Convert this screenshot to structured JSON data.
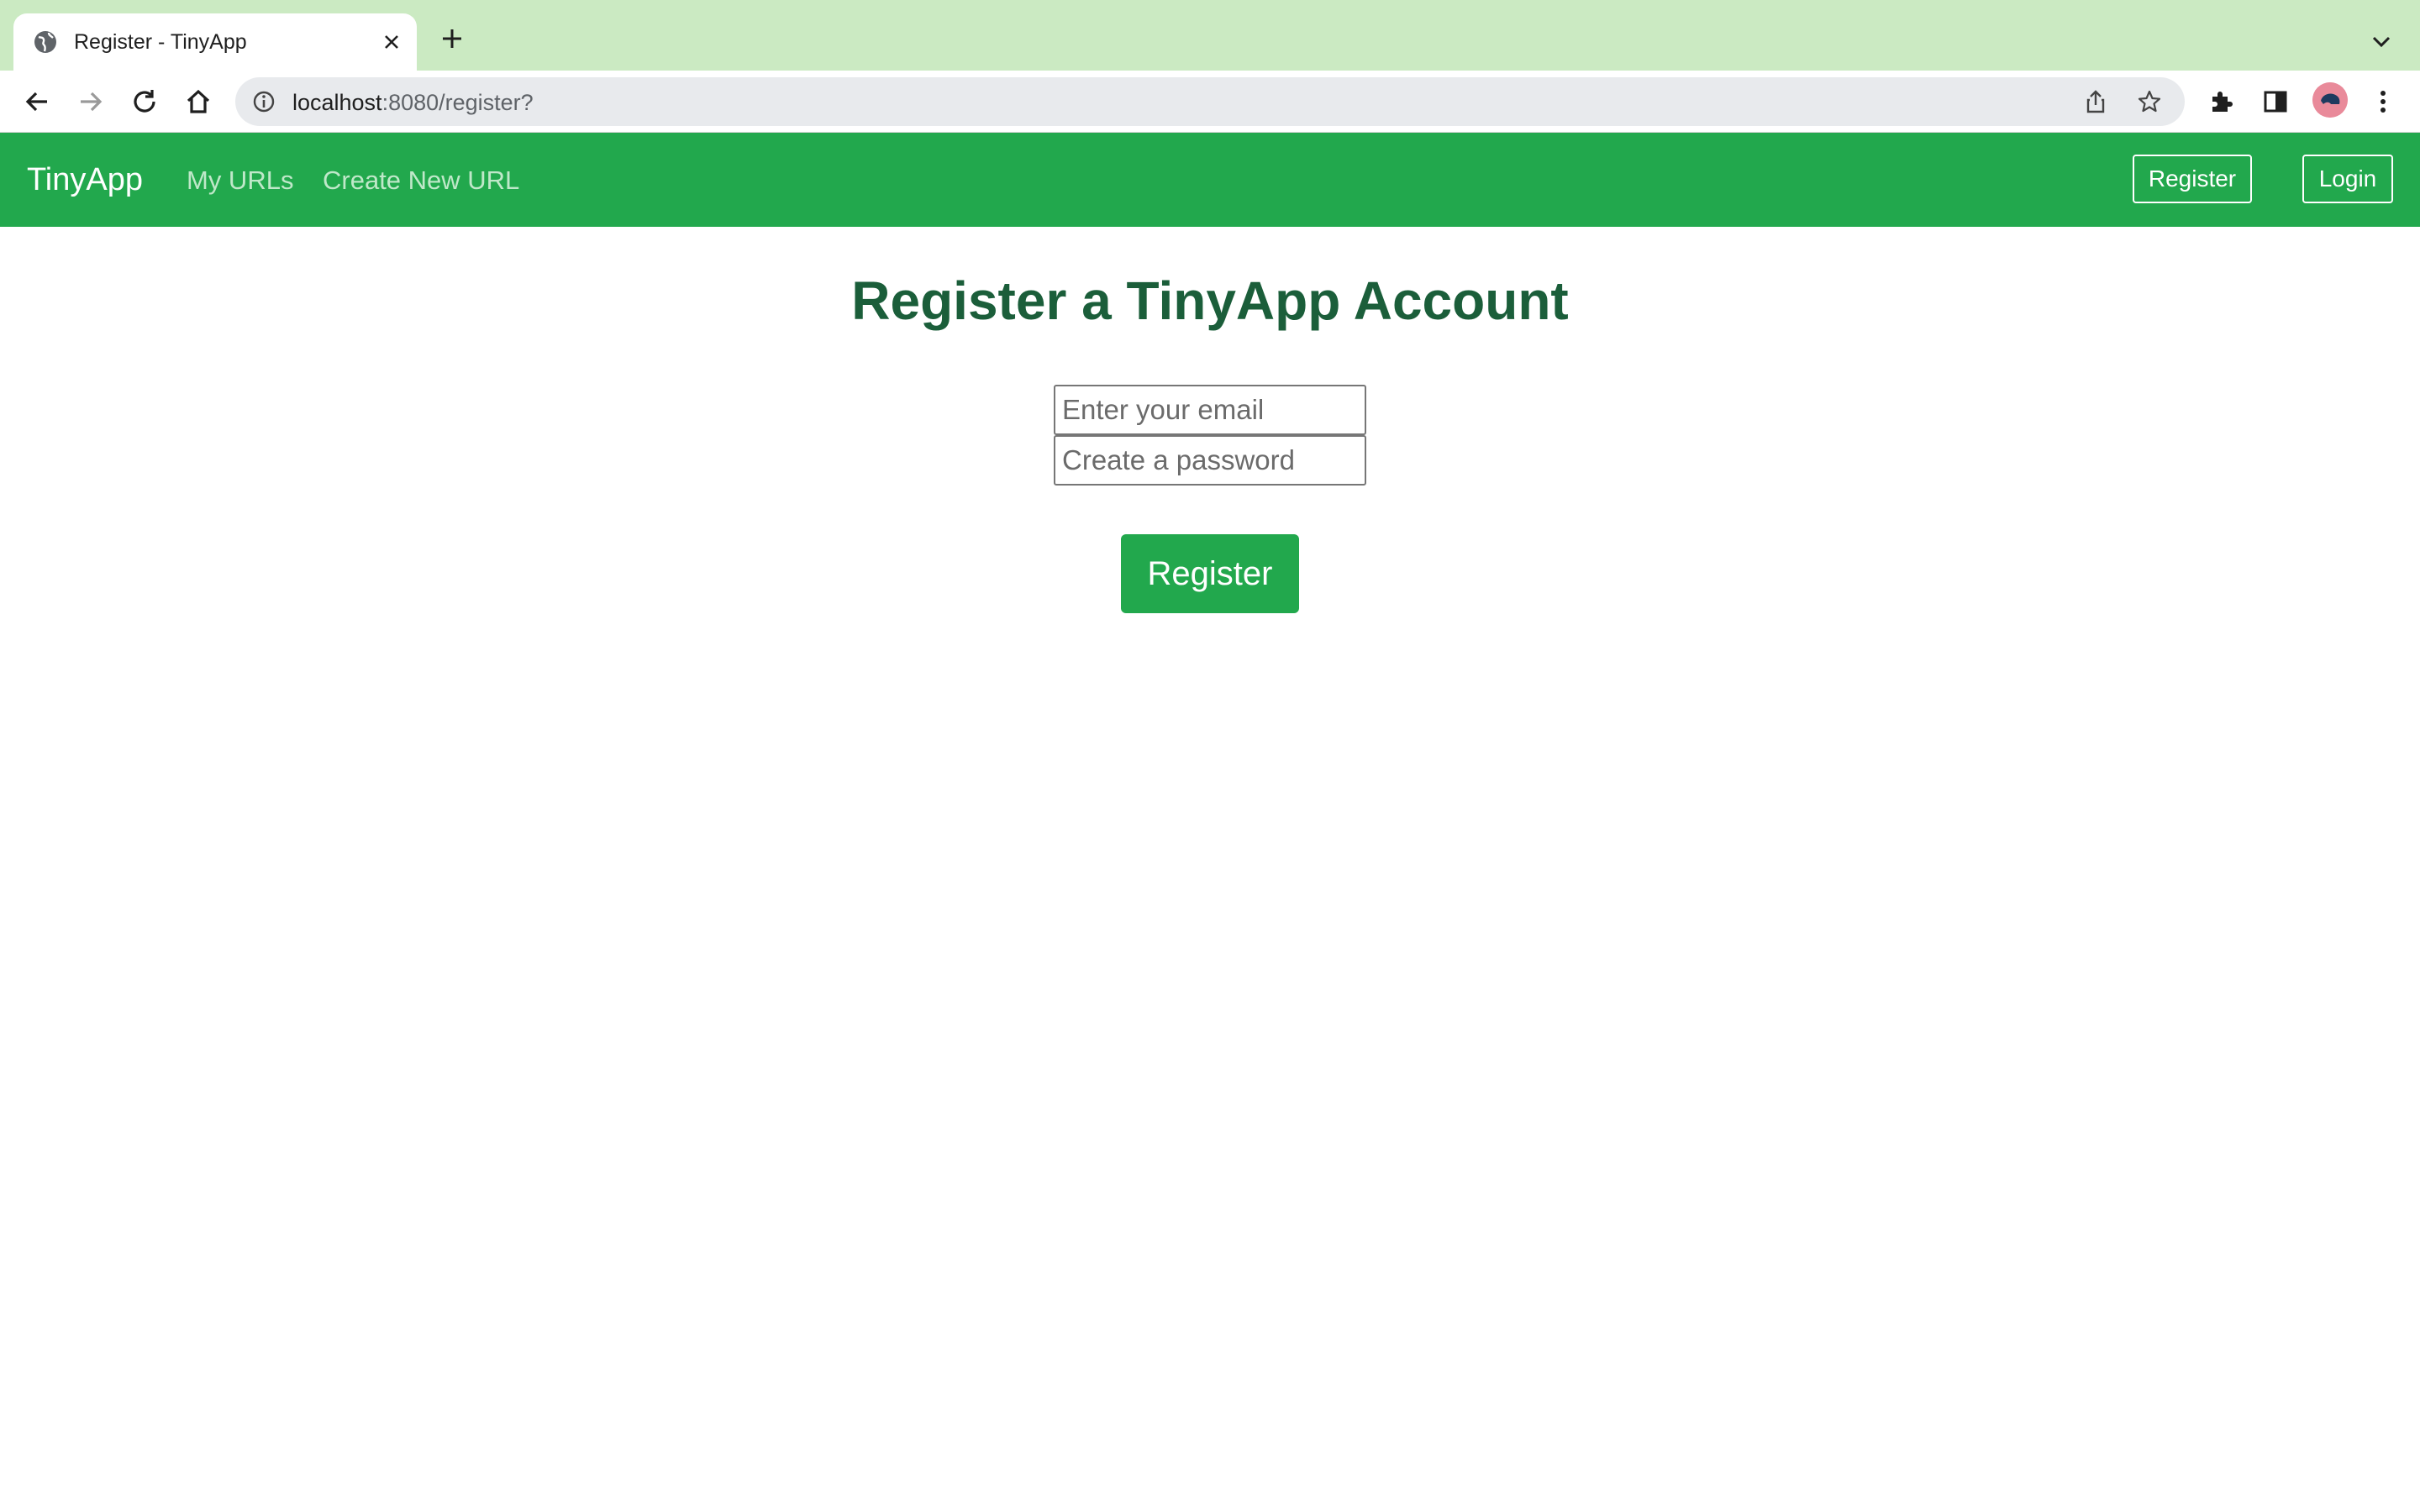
{
  "browser": {
    "tab_title": "Register - TinyApp",
    "url_host": "localhost",
    "url_path": ":8080/register?"
  },
  "navbar": {
    "brand": "TinyApp",
    "links": [
      {
        "label": "My URLs"
      },
      {
        "label": "Create New URL"
      }
    ],
    "register_label": "Register",
    "login_label": "Login"
  },
  "main": {
    "heading": "Register a TinyApp Account",
    "email_placeholder": "Enter your email",
    "password_placeholder": "Create a password",
    "submit_label": "Register"
  },
  "colors": {
    "navbar_bg": "#22a84d",
    "heading": "#1b5e3a",
    "tabstrip_bg": "#cbeac2"
  }
}
